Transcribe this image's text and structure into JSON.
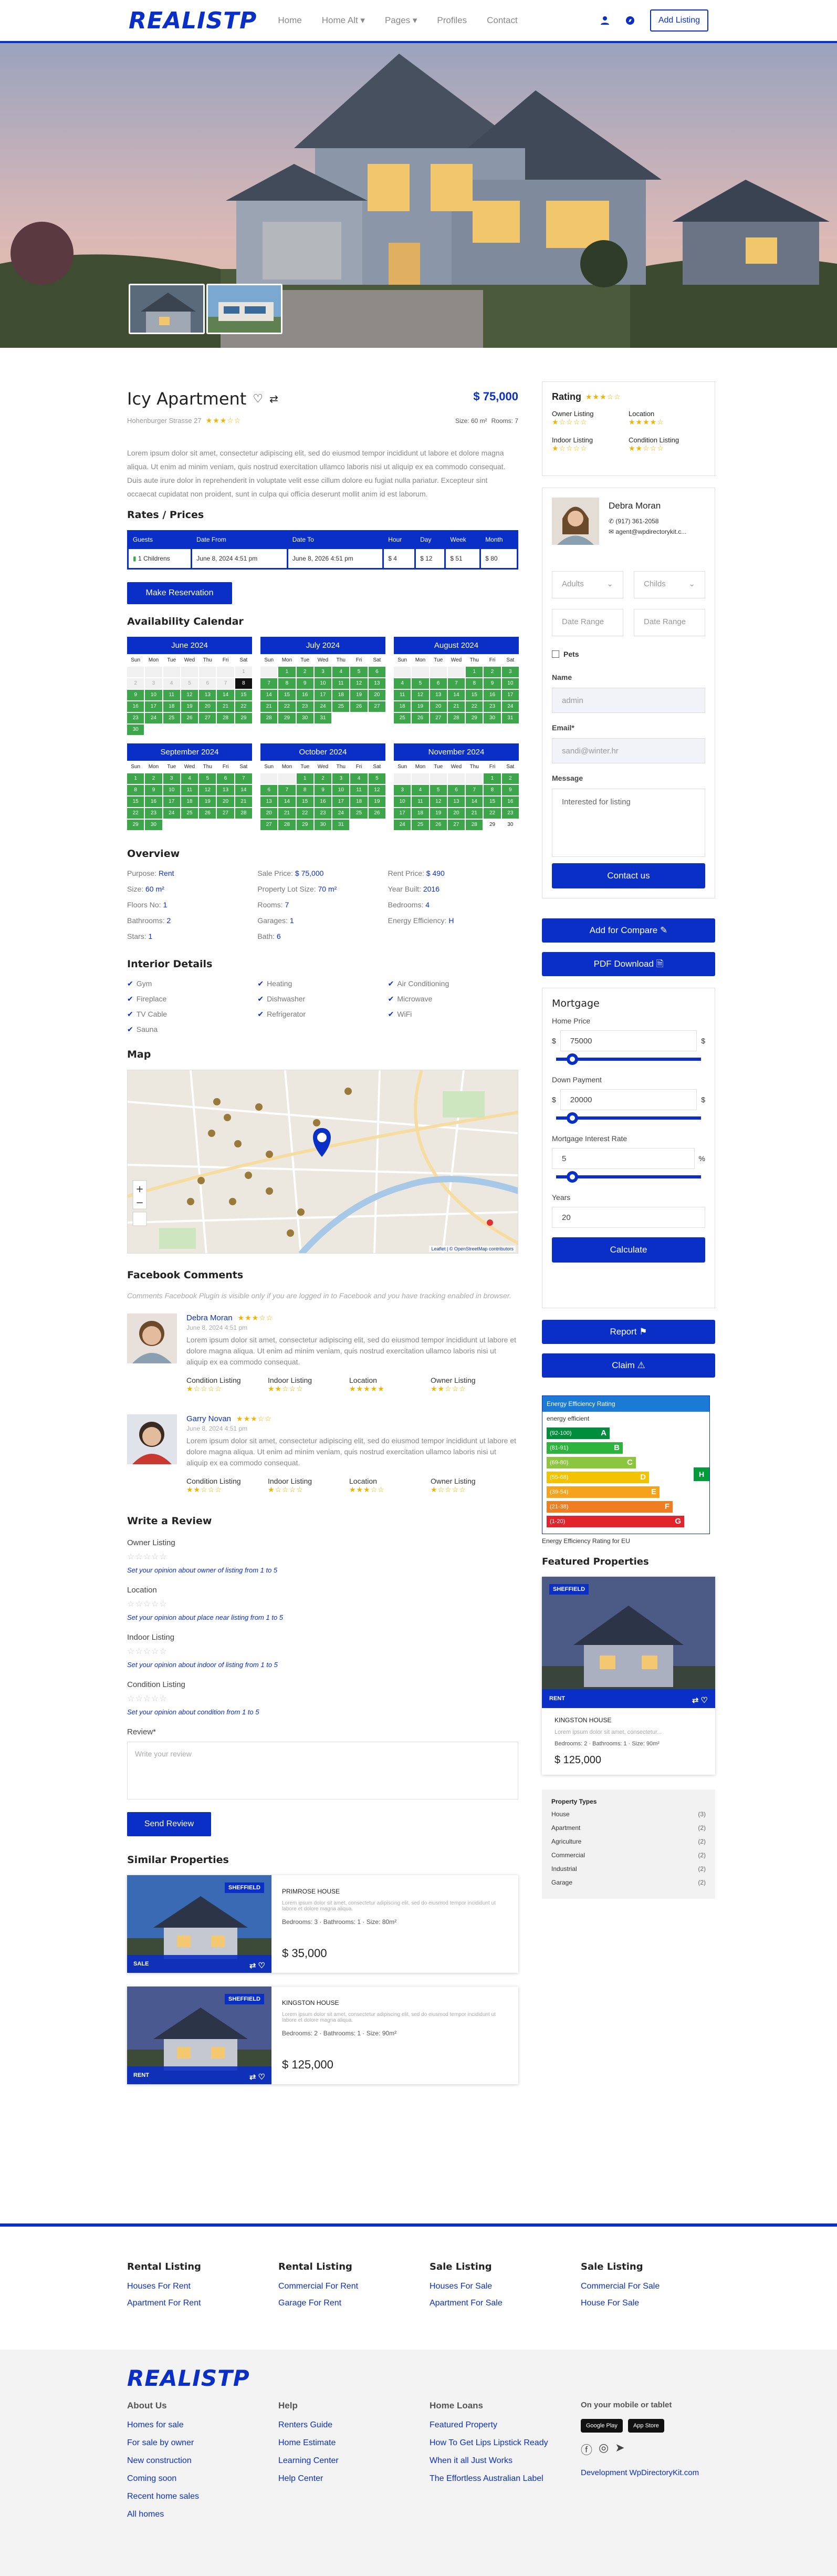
{
  "brand": {
    "logo": "REALISTP"
  },
  "nav": [
    "Home",
    "Home Alt ▾",
    "Pages ▾",
    "Profiles",
    "Contact"
  ],
  "header": {
    "add_listing": "Add Listing"
  },
  "property": {
    "title": "Icy Apartment",
    "price": "$ 75,000",
    "address": "Hohenburger Strasse 27",
    "size": "Size: 60 m²",
    "rooms": "Rooms: 7",
    "description": "Lorem ipsum dolor sit amet, consectetur adipiscing elit, sed do eiusmod tempor incididunt ut labore et dolore magna aliqua. Ut enim ad minim veniam, quis nostrud exercitation ullamco laboris nisi ut aliquip ex ea commodo consequat. Duis aute irure dolor in reprehenderit in voluptate velit esse cillum dolore eu fugiat nulla pariatur. Excepteur sint occaecat cupidatat non proident, sunt in culpa qui officia deserunt mollit anim id est laborum."
  },
  "rates": {
    "title": "Rates / Prices",
    "headers": [
      "Guests",
      "Date From",
      "Date To",
      "Hour",
      "Day",
      "Week",
      "Month"
    ],
    "row": [
      "1 Childrens",
      "June 8, 2024 4:51 pm",
      "June 8, 2026 4:51 pm",
      "$ 4",
      "$ 12",
      "$ 51",
      "$ 80"
    ],
    "reserve": "Make Reservation"
  },
  "calendar": {
    "title": "Availability Calendar",
    "weekdays": [
      "Sun",
      "Mon",
      "Tue",
      "Wed",
      "Thu",
      "Fri",
      "Sat"
    ],
    "months": [
      {
        "name": "June 2024"
      },
      {
        "name": "July 2024"
      },
      {
        "name": "August 2024"
      },
      {
        "name": "September 2024"
      },
      {
        "name": "October 2024"
      },
      {
        "name": "November 2024"
      }
    ]
  },
  "overview": {
    "title": "Overview",
    "items": [
      [
        "Purpose:",
        "Rent"
      ],
      [
        "Sale Price:",
        "$ 75,000"
      ],
      [
        "Rent Price:",
        "$ 490"
      ],
      [
        "Size:",
        "60 m²"
      ],
      [
        "Property Lot Size:",
        "70 m²"
      ],
      [
        "Year Built:",
        "2016"
      ],
      [
        "Floors No:",
        "1"
      ],
      [
        "Rooms:",
        "7"
      ],
      [
        "Bedrooms:",
        "4"
      ],
      [
        "Bathrooms:",
        "2"
      ],
      [
        "Garages:",
        "1"
      ],
      [
        "Energy Efficiency:",
        "H"
      ],
      [
        "Stars:",
        "1"
      ],
      [
        "Bath:",
        "6"
      ],
      [
        "",
        ""
      ]
    ]
  },
  "interior": {
    "title": "Interior Details",
    "items": [
      "Gym",
      "Heating",
      "Air Conditioning",
      "Fireplace",
      "Dishwasher",
      "Microwave",
      "TV Cable",
      "Refrigerator",
      "WiFi",
      "Sauna"
    ]
  },
  "map": {
    "title": "Map",
    "attribution": "Leaflet | © OpenStreetMap contributors"
  },
  "comments": {
    "title": "Facebook Comments",
    "note": "Comments Facebook Plugin is visible only if you are logged in to Facebook and you have tracking enabled in browser.",
    "items": [
      {
        "name": "Debra Moran",
        "date": "June 8, 2024 4:51 pm",
        "text": "Lorem ipsum dolor sit amet, consectetur adipiscing elit, sed do eiusmod tempor incididunt ut labore et dolore magna aliqua. Ut enim ad minim veniam, quis nostrud exercitation ullamco laboris nisi ut aliquip ex ea commodo consequat.",
        "ratings": [
          "Condition Listing",
          "Indoor Listing",
          "Location",
          "Owner Listing"
        ]
      },
      {
        "name": "Garry Novan",
        "date": "June 8, 2024 4:51 pm",
        "text": "Lorem ipsum dolor sit amet, consectetur adipiscing elit, sed do eiusmod tempor incididunt ut labore et dolore magna aliqua. Ut enim ad minim veniam, quis nostrud exercitation ullamco laboris nisi ut aliquip ex ea commodo consequat.",
        "ratings": [
          "Condition Listing",
          "Indoor Listing",
          "Location",
          "Owner Listing"
        ]
      }
    ]
  },
  "review": {
    "title": "Write a Review",
    "fields": [
      {
        "label": "Owner Listing",
        "hint": "Set your opinion about owner of listing from 1 to 5"
      },
      {
        "label": "Location",
        "hint": "Set your opinion about place near listing from 1 to 5"
      },
      {
        "label": "Indoor Listing",
        "hint": "Set your opinion about indoor of listing from 1 to 5"
      },
      {
        "label": "Condition Listing",
        "hint": "Set your opinion about condition from 1 to 5"
      }
    ],
    "review_label": "Review*",
    "placeholder": "Write your review",
    "send": "Send Review"
  },
  "similar": {
    "title": "Similar Properties",
    "items": [
      {
        "name": "PRIMROSE HOUSE",
        "text": "Lorem ipsum dolor sit amet, consectetur adipiscing elit, sed do eiusmod tempor incididunt ut labore et dolore magna aliqua.",
        "meta": "Bedrooms: 3  ·  Bathrooms: 1  ·  Size: 80m²",
        "price": "$ 35,000",
        "city": "SHEFFIELD",
        "status": "SALE"
      },
      {
        "name": "KINGSTON HOUSE",
        "text": "Lorem ipsum dolor sit amet, consectetur adipiscing elit, sed do eiusmod tempor incididunt ut labore et dolore magna aliqua.",
        "meta": "Bedrooms: 2  ·  Bathrooms: 1  ·  Size: 90m²",
        "price": "$ 125,000",
        "city": "SHEFFIELD",
        "status": "RENT"
      }
    ]
  },
  "rating_box": {
    "title": "Rating",
    "items": [
      "Owner Listing",
      "Location",
      "Indoor Listing",
      "Condition Listing"
    ]
  },
  "agent": {
    "name": "Debra Moran",
    "phone": "(917) 361-2058",
    "email": "agent@wpdirectorykit.c..."
  },
  "booking": {
    "adults": "Adults",
    "childs": "Childs",
    "date_from": "Date Range",
    "date_to": "Date Range",
    "pets": "Pets",
    "name_label": "Name",
    "name_value": "admin",
    "email_label": "Email*",
    "email_value": "sandi@winter.hr",
    "message_label": "Message",
    "message_value": "Interested for listing",
    "contact": "Contact us"
  },
  "compare": "Add for Compare",
  "pdf": "PDF Download",
  "mortgage": {
    "title": "Mortgage",
    "home_price": "Home Price",
    "home_value": "75000",
    "down": "Down Payment",
    "down_value": "20000",
    "rate": "Mortgage Interest Rate",
    "rate_value": "5",
    "years": "Years",
    "years_value": "20",
    "calculate": "Calculate",
    "currency": "$",
    "percent": "%"
  },
  "report": "Report",
  "claim": "Claim",
  "energy": {
    "title": "Energy Efficiency Rating",
    "sub": "energy efficient",
    "caption": "Energy Efficiency Rating for EU",
    "current": "H",
    "bands": [
      {
        "range": "(92-100)",
        "letter": "A",
        "color": "#008d3c"
      },
      {
        "range": "(81-91)",
        "letter": "B",
        "color": "#2db43d"
      },
      {
        "range": "(69-80)",
        "letter": "C",
        "color": "#8cc63f"
      },
      {
        "range": "(55-68)",
        "letter": "D",
        "color": "#f4c300"
      },
      {
        "range": "(39-54)",
        "letter": "E",
        "color": "#f7a21b"
      },
      {
        "range": "(21-38)",
        "letter": "F",
        "color": "#ef7d22"
      },
      {
        "range": "(1-20)",
        "letter": "G",
        "color": "#e2232b"
      }
    ]
  },
  "featured": {
    "title": "Featured Properties",
    "name": "KINGSTON HOUSE",
    "text": "Lorem ipsum dolor sit amet, consectetur...",
    "meta": "Bedrooms: 2  ·  Bathrooms: 1  ·  Size: 90m²",
    "price": "$ 125,000",
    "city": "SHEFFIELD",
    "status": "RENT"
  },
  "types": {
    "title": "Property Types",
    "items": [
      [
        "House",
        "(3)"
      ],
      [
        "Apartment",
        "(2)"
      ],
      [
        "Agriculture",
        "(2)"
      ],
      [
        "Commercial",
        "(2)"
      ],
      [
        "Industrial",
        "(2)"
      ],
      [
        "Garage",
        "(2)"
      ]
    ]
  },
  "footer_links": [
    {
      "title": "Rental Listing",
      "links": [
        "Houses For Rent",
        "Apartment For Rent"
      ]
    },
    {
      "title": "Rental Listing",
      "links": [
        "Commercial For Rent",
        "Garage For Rent"
      ]
    },
    {
      "title": "Sale Listing",
      "links": [
        "Houses For Sale",
        "Apartment For Sale"
      ]
    },
    {
      "title": "Sale Listing",
      "links": [
        "Commercial For Sale",
        "House For Sale"
      ]
    }
  ],
  "footer": {
    "about": {
      "title": "About Us",
      "links": [
        "Homes for sale",
        "For sale by owner",
        "New construction",
        "Coming soon",
        "Recent home sales",
        "All homes"
      ]
    },
    "help": {
      "title": "Help",
      "links": [
        "Renters Guide",
        "Home Estimate",
        "Learning Center",
        "Help Center"
      ]
    },
    "loans": {
      "title": "Home Loans",
      "links": [
        "Featured Property",
        "How To Get Lips Lipstick Ready",
        "When it all Just Works",
        "The Effortless Australian Label"
      ]
    },
    "mobile": {
      "title": "On your mobile or tablet",
      "google": "Google Play",
      "apple": "App Store",
      "credit": "Development WpDirectoryKit.com"
    }
  }
}
